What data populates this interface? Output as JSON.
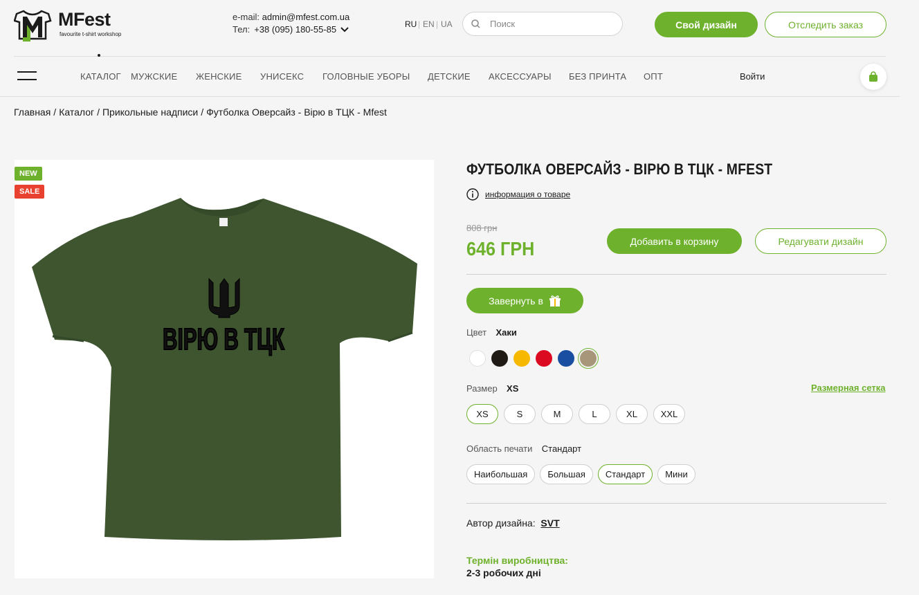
{
  "header": {
    "logo_text": "MFest",
    "logo_sub": "favourite t-shirt workshop",
    "email_label": "e-mail:",
    "email": "admin@mfest.com.ua",
    "phone_label": "Тел:",
    "phone": "+38 (095) 180-55-85",
    "languages": [
      "RU",
      "EN",
      "UA"
    ],
    "active_language": "RU",
    "search_placeholder": "Поиск",
    "design_button": "Свой дизайн",
    "track_button": "Отследить заказ"
  },
  "nav": {
    "items": [
      "КАТАЛОГ",
      "МУЖСКИЕ",
      "ЖЕНСКИЕ",
      "УНИСЕКС",
      "ГОЛОВНЫЕ УБОРЫ",
      "ДЕТСКИЕ",
      "АКСЕССУАРЫ",
      "БЕЗ ПРИНТА",
      "ОПТ"
    ],
    "login": "Войти"
  },
  "breadcrumb": [
    "Главная",
    "Каталог",
    "Прикольные надписи",
    "Футболка Оверсайз - Вірю в ТЦК - Mfest"
  ],
  "product": {
    "badges": [
      "NEW",
      "SALE"
    ],
    "print_text": "ВІРЮ В ТЦК",
    "title": "ФУТБОЛКА ОВЕРСАЙЗ - ВІРЮ В ТЦК - MFEST",
    "info_link": "информация о товаре",
    "old_price": "808 грн",
    "price": "646 ГРН",
    "add_to_cart": "Добавить в корзину",
    "edit_design": "Редагувати дизайн",
    "gift_button": "Завернуть в",
    "color_label": "Цвет",
    "color_value": "Хаки",
    "colors": [
      "#ffffff",
      "#1f1a14",
      "#f6b800",
      "#dc0a20",
      "#1a4ea0",
      "#a8967a"
    ],
    "selected_color_index": 5,
    "size_label": "Размер",
    "size_value": "XS",
    "size_chart": "Размерная сетка",
    "sizes": [
      "XS",
      "S",
      "M",
      "L",
      "XL",
      "XXL"
    ],
    "selected_size": "XS",
    "print_area_label": "Область печати",
    "print_area_value": "Стандарт",
    "print_areas": [
      "Наибольшая",
      "Большая",
      "Стандарт",
      "Мини"
    ],
    "selected_print_area": "Стандарт",
    "author_label": "Автор дизайна:",
    "author": "SVT",
    "production_label": "Термін виробництва:",
    "production_value": "2-3 робочих дні"
  },
  "colors": {
    "accent": "#6eb12d",
    "sale": "#e8412f",
    "shirt": "#3e5530"
  }
}
